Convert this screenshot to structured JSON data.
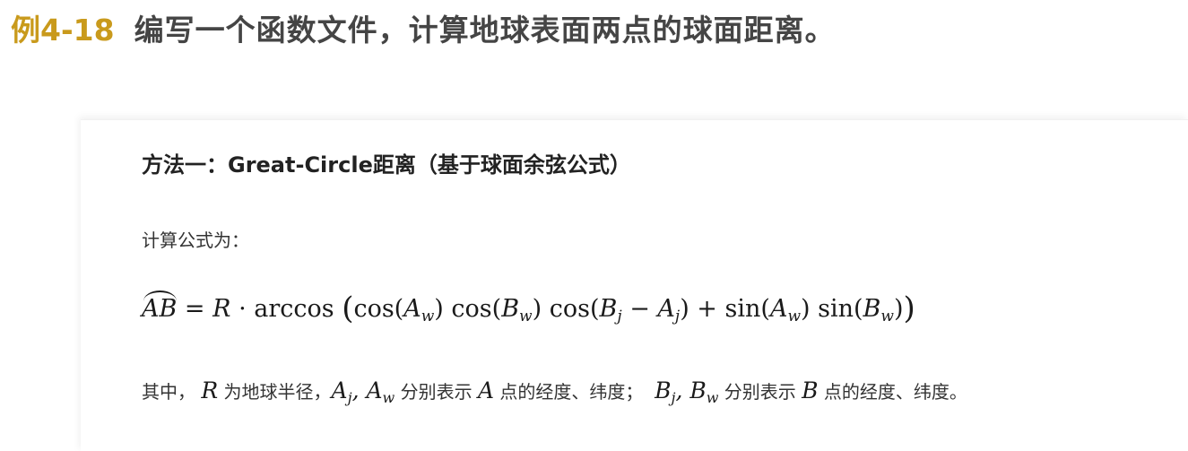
{
  "header": {
    "example_number": "例4-18",
    "title": "编写一个函数文件，计算地球表面两点的球面距离。"
  },
  "content": {
    "method_heading": "方法一：Great-Circle距离（基于球面余弦公式）",
    "intro": "计算公式为：",
    "formula": {
      "lhs": "AB",
      "eq": " = ",
      "body": "R · arccos (cos(A_w) cos(B_w) cos(B_j − A_j) + sin(A_w) sin(B_w))"
    },
    "explanation": {
      "p1": "其中，",
      "R": "R",
      "p2": " 为地球半径，",
      "p3": " 分别表示 ",
      "A": "A",
      "p4": " 点的经度、纬度；",
      "p5": " 分别表示 ",
      "B": "B",
      "p6": " 点的经度、纬度。"
    }
  },
  "colors": {
    "example_number": "#c99a1c",
    "title": "#454545",
    "body_text": "#333333"
  }
}
